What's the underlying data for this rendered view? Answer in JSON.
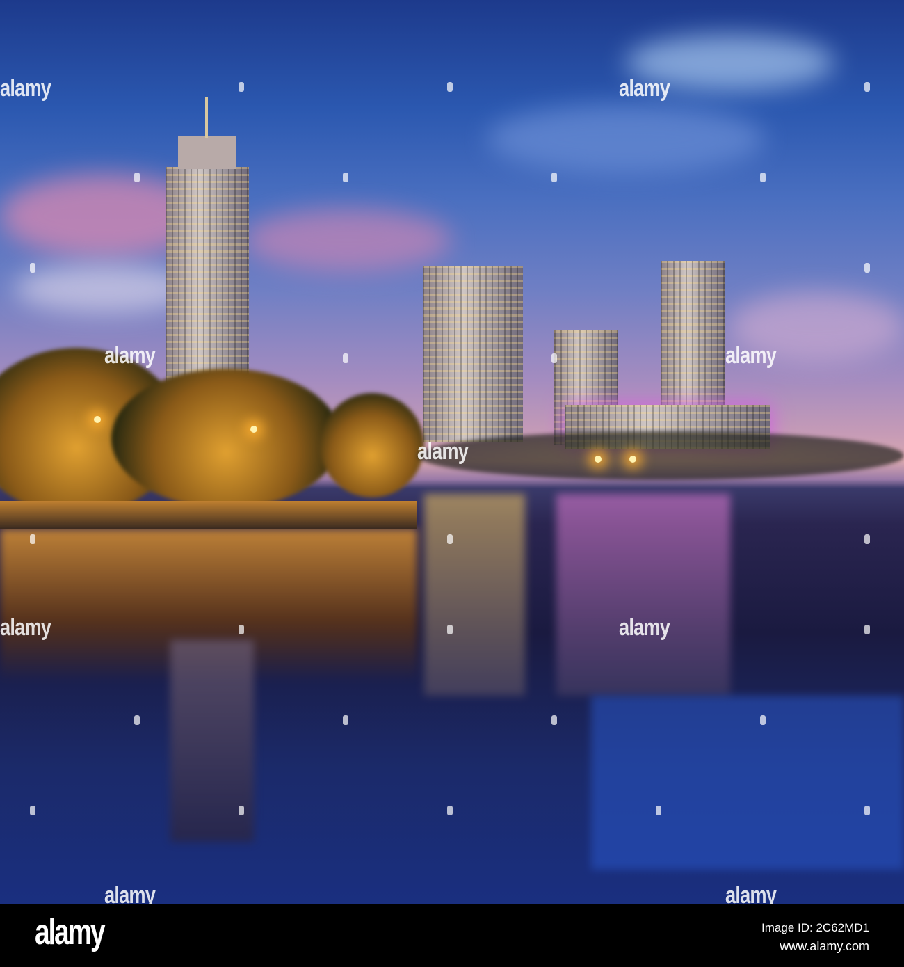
{
  "watermark": {
    "text": "alamy"
  },
  "footer": {
    "logo": "alamy",
    "image_id": "Image ID: 2C62MD1",
    "website": "www.alamy.com"
  }
}
